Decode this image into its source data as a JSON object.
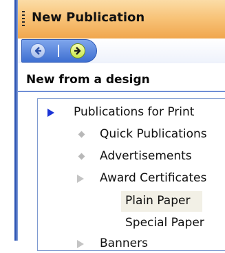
{
  "panel": {
    "title": "New Publication",
    "section_title": "New from a design"
  },
  "nav": {
    "back_icon": "back-arrow-icon",
    "forward_icon": "forward-arrow-icon"
  },
  "tree": {
    "root": {
      "label": "Publications for Print",
      "icon": "expanded-triangle-icon"
    },
    "children": [
      {
        "label": "Quick Publications",
        "icon": "bullet-diamond-icon"
      },
      {
        "label": "Advertisements",
        "icon": "bullet-diamond-icon"
      },
      {
        "label": "Award Certificates",
        "icon": "collapsed-triangle-icon"
      },
      {
        "label": "Plain Paper",
        "selected": true
      },
      {
        "label": "Special Paper"
      },
      {
        "label": "Banners"
      }
    ]
  },
  "colors": {
    "title_bar": "#f8c47a",
    "accent_blue": "#3e6fd1",
    "expand_marker": "#1a33d6",
    "selection": "#f2f0e6"
  }
}
